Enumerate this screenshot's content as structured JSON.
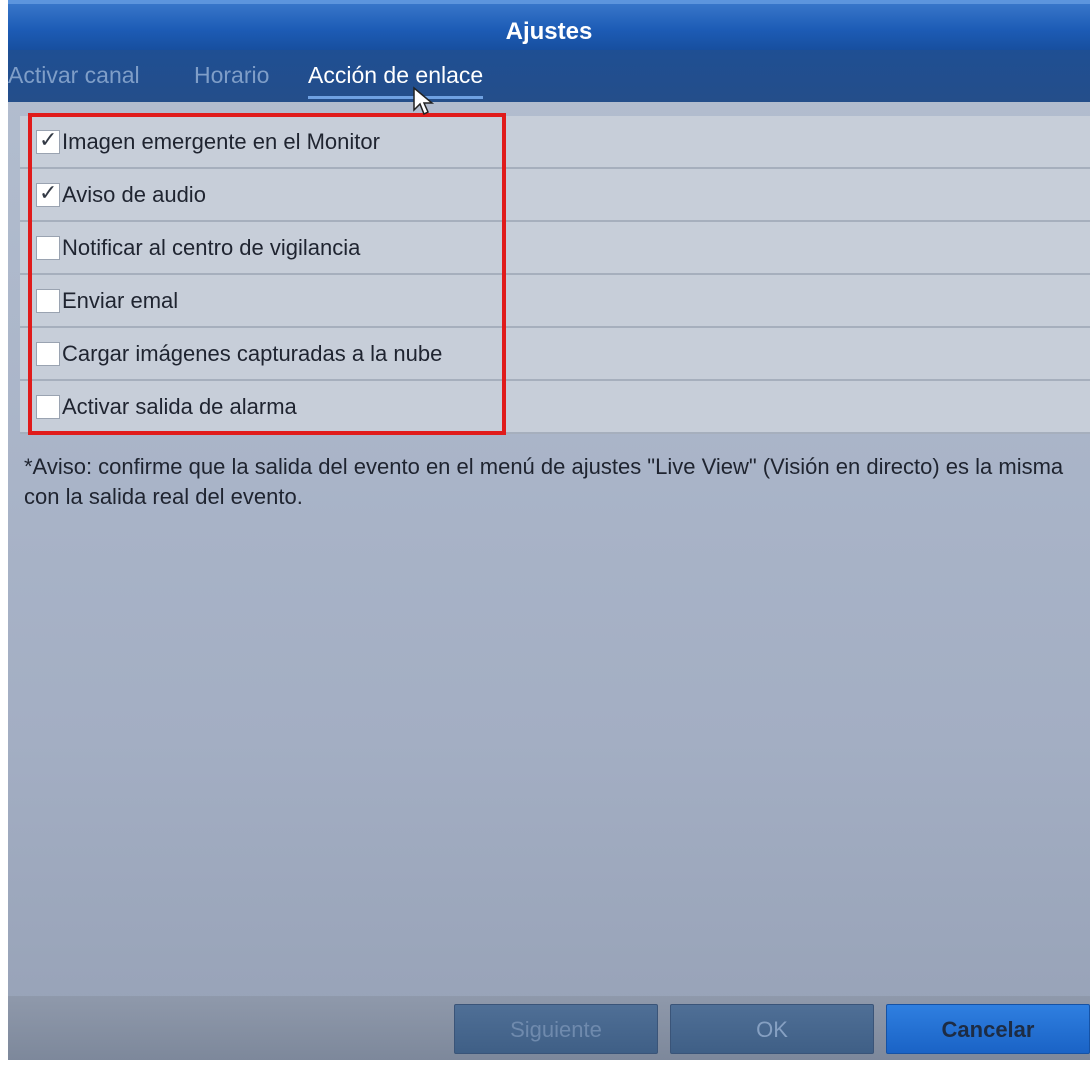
{
  "window": {
    "title": "Ajustes"
  },
  "tabs": [
    {
      "label": "Activar canal",
      "active": false
    },
    {
      "label": "Horario",
      "active": false
    },
    {
      "label": "Acción de enlace",
      "active": true
    }
  ],
  "options": [
    {
      "label": "Imagen emergente en el Monitor",
      "checked": true
    },
    {
      "label": "Aviso de audio",
      "checked": true
    },
    {
      "label": "Notificar al centro de vigilancia",
      "checked": false
    },
    {
      "label": "Enviar emal",
      "checked": false
    },
    {
      "label": "Cargar imágenes capturadas a la nube",
      "checked": false
    },
    {
      "label": "Activar salida de alarma",
      "checked": false
    }
  ],
  "note": "*Aviso: confirme que la salida del evento en el menú de ajustes \"Live View\" (Visión en directo) es la misma con la salida real del evento.",
  "buttons": {
    "next_label": "Siguiente",
    "ok_label": "OK",
    "cancel_label": "Cancelar"
  },
  "colors": {
    "title_bar": "#1d5cb6",
    "highlight_box": "#e01b1b",
    "primary_button": "#1a63c6"
  },
  "icons": {
    "checkbox_checked": "check-mark",
    "cursor": "mouse-pointer"
  }
}
